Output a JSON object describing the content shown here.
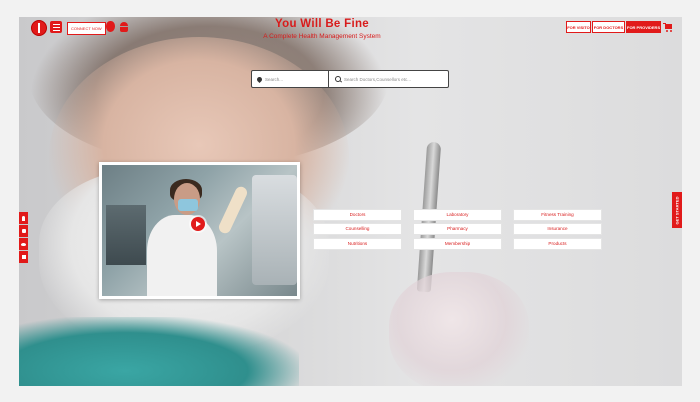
{
  "header": {
    "title": "You Will Be Fine",
    "subtitle": "A Complete Health Management System",
    "connect_label": "CONNECT NOW",
    "buttons": {
      "visitor": "FOR VISITO",
      "doctors": "FOR DOCTORS",
      "providers": "FOR PROVIDERS"
    },
    "icons": [
      "logo-icon",
      "menu-icon",
      "apple-icon",
      "android-icon",
      "cart-icon"
    ]
  },
  "search": {
    "location_placeholder": "Search...",
    "main_placeholder": "Search Doctors,Counsellors etc..."
  },
  "categories": [
    [
      "Doctors",
      "Laboratory",
      "Fitness Training"
    ],
    [
      "Counselling",
      "Pharmacy",
      "Insurance"
    ],
    [
      "Nutritions",
      "Membership",
      "Products"
    ]
  ],
  "social": [
    "facebook-icon",
    "instagram-icon",
    "twitter-icon",
    "linkedin-icon"
  ],
  "side_tab": "GET STARTED",
  "colors": {
    "accent": "#e11a1a",
    "title": "#d81b1b",
    "page_bg": "#f2f2f2"
  }
}
